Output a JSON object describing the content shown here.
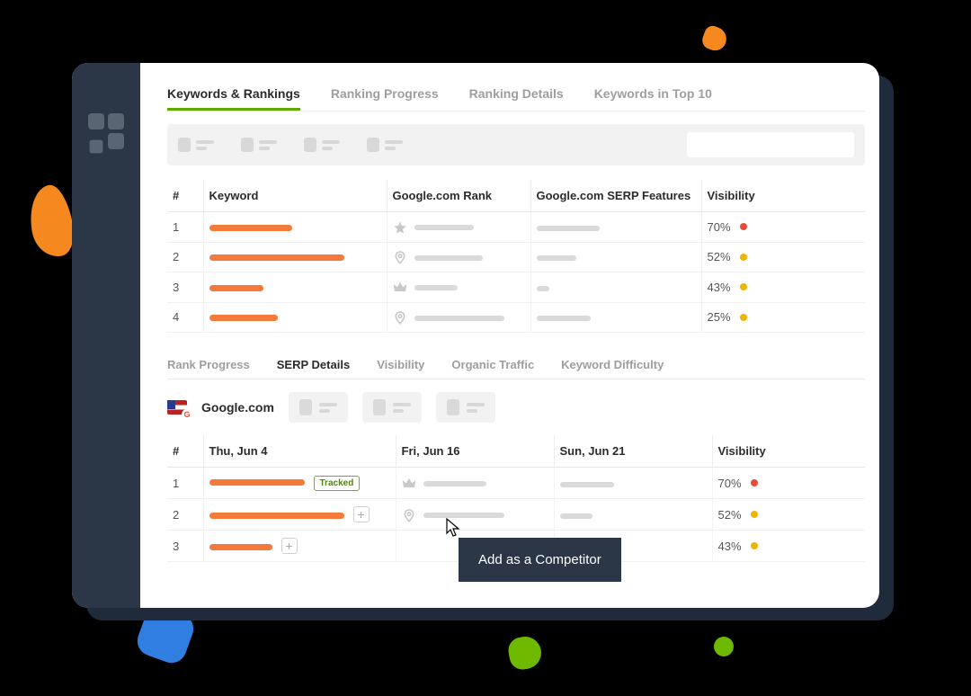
{
  "tabs_top": [
    "Keywords & Rankings",
    "Ranking Progress",
    "Ranking Details",
    "Keywords in Top 10"
  ],
  "tabs_top_active": 0,
  "table1": {
    "headers": {
      "num": "#",
      "keyword": "Keyword",
      "rank": "Google.com Rank",
      "serp": "Google.com SERP Features",
      "vis": "Visibility"
    },
    "rows": [
      {
        "n": "1",
        "barW": 92,
        "icon": "star",
        "rankW": 66,
        "serpW": 70,
        "vis": "70%",
        "dot": "red"
      },
      {
        "n": "2",
        "barW": 150,
        "icon": "pin",
        "rankW": 76,
        "serpW": 44,
        "vis": "52%",
        "dot": "yellow"
      },
      {
        "n": "3",
        "barW": 60,
        "icon": "crown",
        "rankW": 48,
        "serpW": 14,
        "vis": "43%",
        "dot": "yellow"
      },
      {
        "n": "4",
        "barW": 76,
        "icon": "pin",
        "rankW": 100,
        "serpW": 60,
        "vis": "25%",
        "dot": "yellow"
      }
    ]
  },
  "tabs_sub": [
    "Rank Progress",
    "SERP Details",
    "Visibility",
    "Organic Traffic",
    "Keyword Difficulty"
  ],
  "tabs_sub_active": 1,
  "search_engine": "Google.com",
  "table2": {
    "headers": {
      "num": "#",
      "d1": "Thu, Jun 4",
      "d2": "Fri, Jun 16",
      "d3": "Sun, Jun 21",
      "vis": "Visibility"
    },
    "rows": [
      {
        "n": "1",
        "barW": 106,
        "badge": "Tracked",
        "icon": "crown",
        "c2W": 70,
        "c3W": 60,
        "vis": "70%",
        "dot": "red"
      },
      {
        "n": "2",
        "barW": 150,
        "plus": true,
        "icon": "pin",
        "c2W": 90,
        "c3W": 36,
        "vis": "52%",
        "dot": "yellow"
      },
      {
        "n": "3",
        "barW": 70,
        "plus": true,
        "icon": "",
        "c2W": 0,
        "c3W": 0,
        "vis": "43%",
        "dot": "yellow"
      }
    ]
  },
  "tooltip": "Add as a Competitor"
}
